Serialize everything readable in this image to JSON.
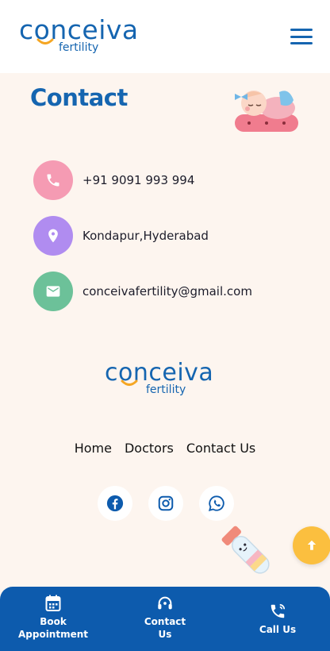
{
  "brand": {
    "name": "conceiva",
    "tagline": "fertility"
  },
  "contact": {
    "title": "Contact",
    "phone": "+91 9091 993 994",
    "location": "Kondapur,Hyderabad",
    "email": "conceivafertility@gmail.com"
  },
  "footer": {
    "nav": [
      "Home",
      "Doctors",
      "Contact Us"
    ],
    "social": [
      "facebook-icon",
      "instagram-icon",
      "whatsapp-icon"
    ]
  },
  "bottom_bar": {
    "book_line1": "Book",
    "book_line2": "Appointment",
    "contact_line1": "Contact",
    "contact_line2": "Us",
    "call": "Call Us"
  },
  "colors": {
    "brand_blue": "#1565b0",
    "bar_blue": "#0d5bad",
    "background": "#fdf5ef",
    "phone_icon_bg": "#f59bb3",
    "location_icon_bg": "#b08cf0",
    "email_icon_bg": "#6cc199",
    "scroll_top": "#fbbf3f"
  }
}
